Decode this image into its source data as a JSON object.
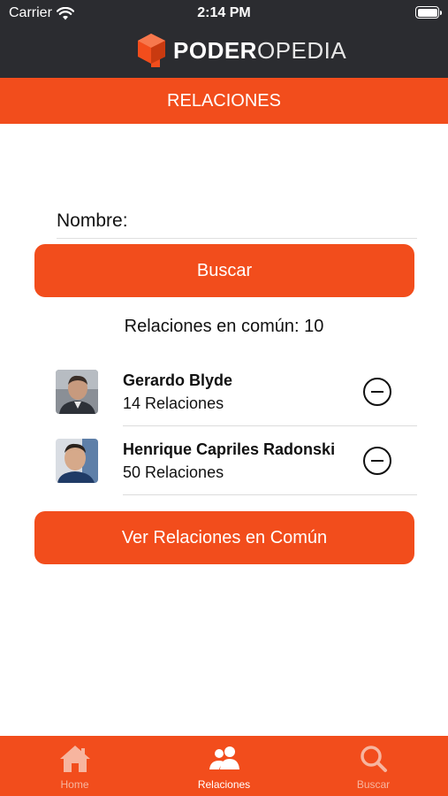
{
  "status_bar": {
    "carrier": "Carrier",
    "time": "2:14 PM"
  },
  "brand": {
    "name_bold": "PODER",
    "name_light": "OPEDIA"
  },
  "title_bar": {
    "title": "RELACIONES"
  },
  "form": {
    "name_label": "Nombre:",
    "name_value": "",
    "search_button": "Buscar"
  },
  "common": {
    "summary": "Relaciones en común: 10"
  },
  "people": [
    {
      "name": "Gerardo Blyde",
      "relations": "14 Relaciones",
      "avatar_icon": "person-photo"
    },
    {
      "name": "Henrique Capriles Radonski",
      "relations": "50 Relaciones",
      "avatar_icon": "person-photo"
    }
  ],
  "actions": {
    "view_common_button": "Ver Relaciones en Común"
  },
  "tabbar": {
    "tabs": [
      {
        "label": "Home",
        "icon": "home-icon",
        "active": false
      },
      {
        "label": "Relaciones",
        "icon": "people-icon",
        "active": true
      },
      {
        "label": "Buscar",
        "icon": "search-icon",
        "active": false
      }
    ]
  },
  "colors": {
    "accent": "#f24d1c",
    "header_bg": "#2b2c30",
    "tab_inactive": "#f7b59f"
  }
}
